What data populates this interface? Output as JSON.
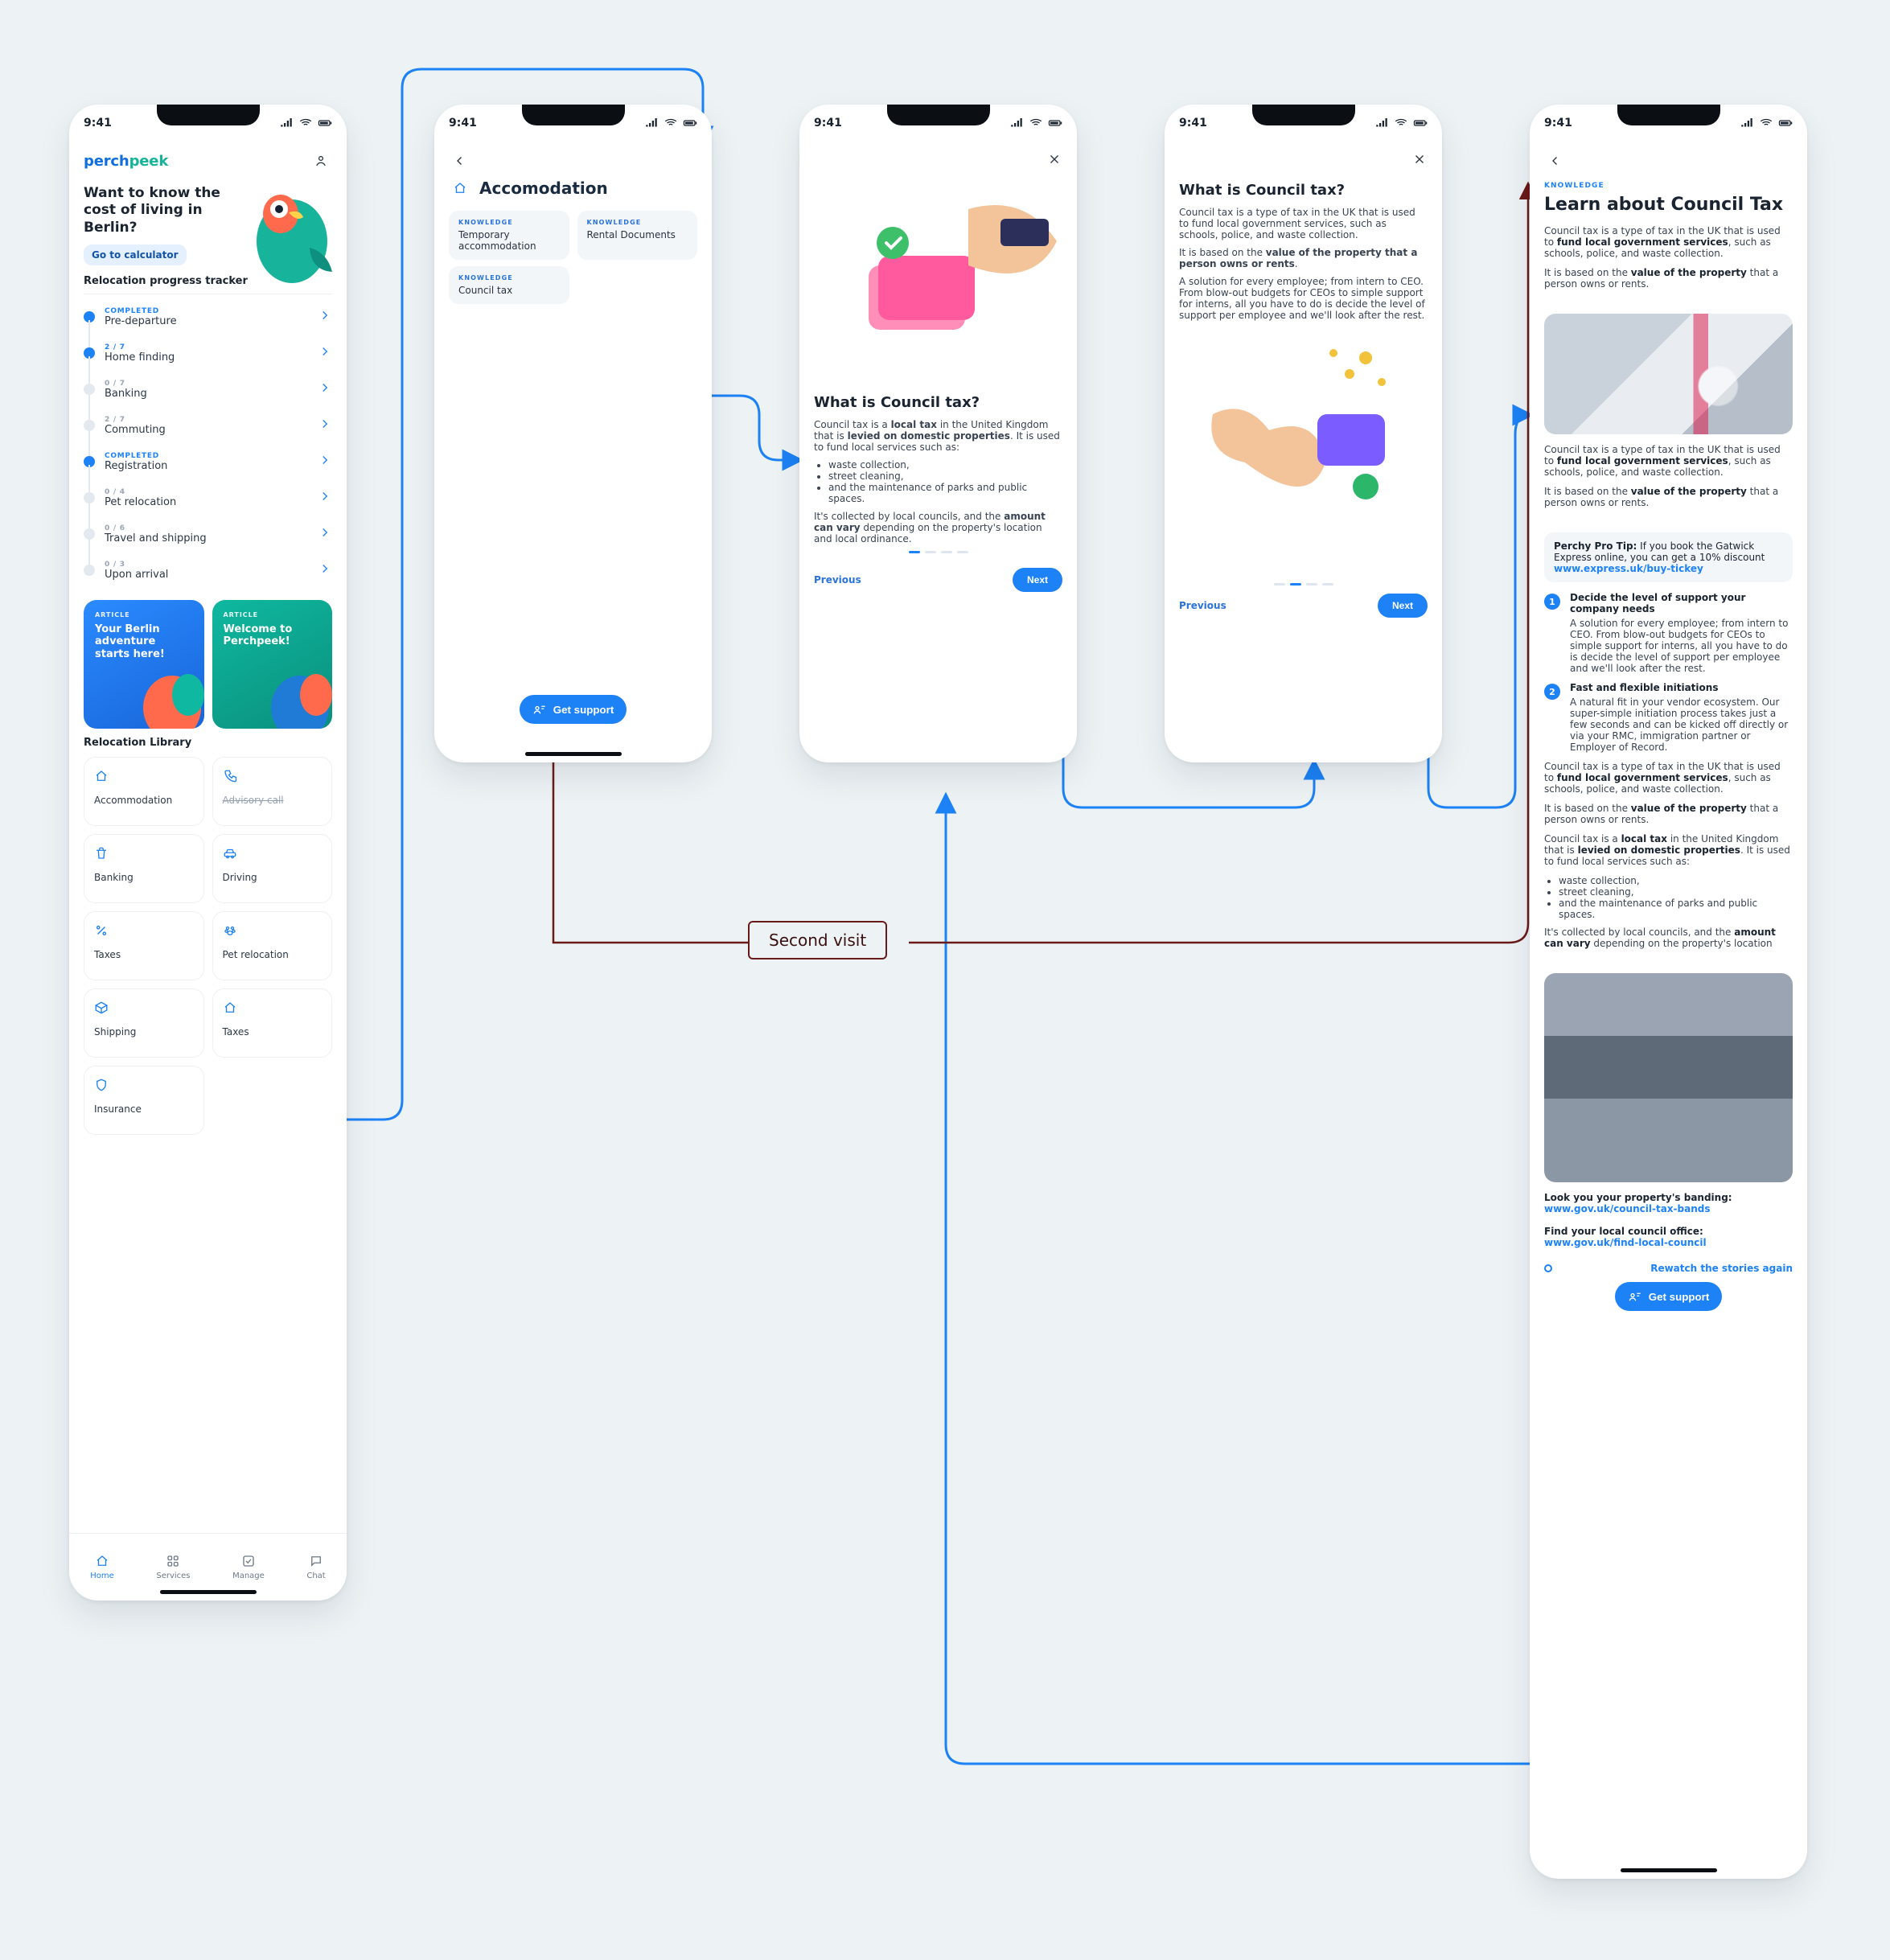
{
  "flow": {
    "second_visit": "Second visit"
  },
  "status": {
    "time": "9:41"
  },
  "s1": {
    "brand": {
      "a": "perch",
      "b": "peek"
    },
    "hero": {
      "line1": "Want to know the",
      "line2_bold": "cost of living in Berlin?",
      "cta": "Go to calculator"
    },
    "tracker_title": "Relocation progress tracker",
    "steps": [
      {
        "meta": "COMPLETED",
        "name": "Pre-departure",
        "done": true
      },
      {
        "meta": "2 / 7",
        "name": "Home finding",
        "done": true
      },
      {
        "meta": "0 / 7",
        "name": "Banking",
        "done": false
      },
      {
        "meta": "2 / 7",
        "name": "Commuting",
        "done": false
      },
      {
        "meta": "COMPLETED",
        "name": "Registration",
        "done": true
      },
      {
        "meta": "0 / 4",
        "name": "Pet relocation",
        "done": false
      },
      {
        "meta": "0 / 6",
        "name": "Travel and shipping",
        "done": false
      },
      {
        "meta": "0 / 3",
        "name": "Upon arrival",
        "done": false
      }
    ],
    "promos": [
      {
        "tag": "ARTICLE",
        "text": "Your Berlin adventure starts here!"
      },
      {
        "tag": "ARTICLE",
        "text": "Welcome to Perchpeek!"
      }
    ],
    "library_title": "Relocation Library",
    "library": [
      {
        "label": "Accommodation",
        "icon": "home-icon",
        "strike": false
      },
      {
        "label": "Advisory call",
        "icon": "phone-icon",
        "strike": true
      },
      {
        "label": "Banking",
        "icon": "trash-icon",
        "strike": false
      },
      {
        "label": "Driving",
        "icon": "car-icon",
        "strike": false
      },
      {
        "label": "Taxes",
        "icon": "percent-icon",
        "strike": false
      },
      {
        "label": "Pet relocation",
        "icon": "paw-icon",
        "strike": false
      },
      {
        "label": "Shipping",
        "icon": "box-icon",
        "strike": false
      },
      {
        "label": "Taxes",
        "icon": "home-icon",
        "strike": false
      },
      {
        "label": "Insurance",
        "icon": "shield-icon",
        "strike": false
      }
    ],
    "tabs": [
      {
        "label": "Home",
        "active": true
      },
      {
        "label": "Services",
        "active": false
      },
      {
        "label": "Manage",
        "active": false
      },
      {
        "label": "Chat",
        "active": false
      }
    ]
  },
  "s2": {
    "title": "Accomodation",
    "topics": [
      {
        "k": "KNOWLEDGE",
        "t": "Temporary accommodation"
      },
      {
        "k": "KNOWLEDGE",
        "t": "Rental Documents"
      },
      {
        "k": "KNOWLEDGE",
        "t": "Council tax"
      }
    ],
    "support": "Get support"
  },
  "s3": {
    "title": "What is Council tax?",
    "p1a": "Council tax is a ",
    "p1b": "local tax",
    "p1c": " in the United Kingdom that is ",
    "p1d": "levied on domestic properties",
    "p1e": ". It is used to fund local services such as:",
    "bullets": [
      "waste collection,",
      "street cleaning,",
      "and the maintenance of parks and public spaces."
    ],
    "p2a": "It's collected by local councils, and the ",
    "p2b": "amount can vary",
    "p2c": " depending on the property's location and local ordinance.",
    "prev": "Previous",
    "next": "Next"
  },
  "s4": {
    "title": "What is Council tax?",
    "p1": "Council tax is a type of tax in the UK that is used to fund local government services, such as schools, police, and waste collection.",
    "p2a": "It is based on the ",
    "p2b": "value of the property that a person owns or rents",
    "p2c": ".",
    "p3": "A solution for every employee; from intern to CEO. From blow-out budgets for CEOs to simple support for interns, all you have to do is decide the level of support per employee and we'll look after the rest.",
    "prev": "Previous",
    "next": "Next"
  },
  "s5": {
    "k": "KNOWLEDGE",
    "title": "Learn about Council Tax",
    "p1a": "Council tax is a type of tax in the UK that is used to ",
    "p1b": "fund local government services",
    "p1c": ", such as schools, police, and waste collection.",
    "p2a": "It is based on the ",
    "p2b": "value of the property",
    "p2c": " that a person owns or rents.",
    "tip_label": "Perchy Pro Tip:",
    "tip_text": " If you book the Gatwick Express online, you can get a 10% discount",
    "tip_link": "www.express.uk/buy-tickey",
    "steps": [
      {
        "title": "Decide the level of support your company needs",
        "body": "A solution for every employee; from intern to CEO. From blow-out budgets for CEOs to simple support for interns, all you have to do is decide the level of support per employee and we'll look after the rest."
      },
      {
        "title": "Fast and flexible initiations",
        "body": "A natural fit in your vendor ecosystem. Our super-simple initiation process takes just a few seconds and can be kicked off directly or via your RMC, immigration partner or Employer of Record."
      }
    ],
    "p_local_a": "Council tax is a ",
    "p_local_b": "local tax",
    "p_local_c": " in the United Kingdom that is ",
    "p_local_d": "levied on domestic properties",
    "p_local_e": ". It is used to fund local services such as:",
    "bullets": [
      "waste collection,",
      "street cleaning,",
      "and the maintenance of parks and public spaces."
    ],
    "p_col_a": "It's collected by local councils, and the ",
    "p_col_b": "amount can vary",
    "p_col_c": " depending on the property's location",
    "band_label": "Look you your property's banding:",
    "band_link": "www.gov.uk/council-tax-bands",
    "council_label": "Find your local council office:",
    "council_link": "www.gov.uk/find-local-council",
    "rewatch": "Rewatch the stories again",
    "support": "Get support"
  }
}
